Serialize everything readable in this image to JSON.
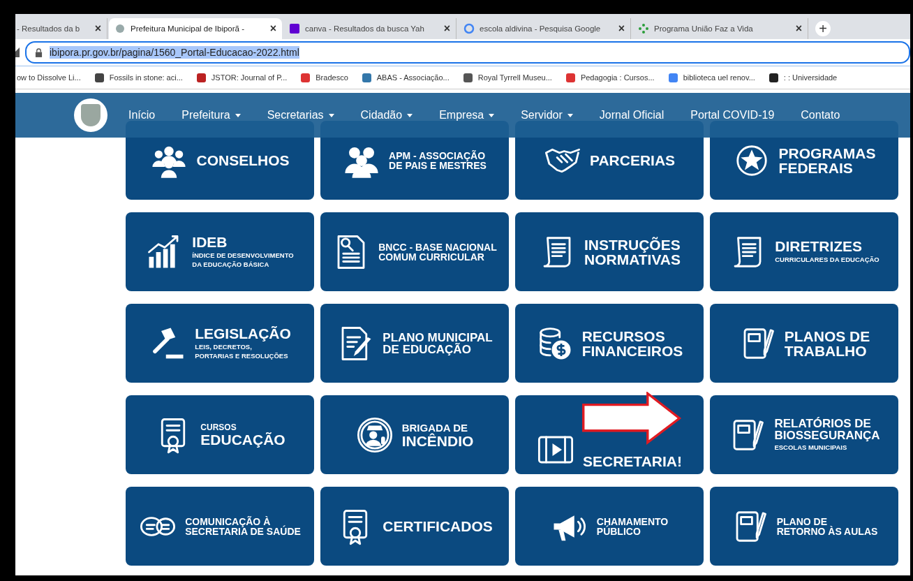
{
  "browser": {
    "tabs": [
      {
        "label": "- Resultados da b",
        "close": "×",
        "selected": false
      },
      {
        "label": "Prefeitura Municipal de Ibiporã -",
        "close": "×",
        "selected": true
      },
      {
        "label": "canva - Resultados da busca Yah",
        "close": "×",
        "selected": false
      },
      {
        "label": "escola aldivina - Pesquisa Google",
        "close": "×",
        "selected": false
      },
      {
        "label": "Programa União Faz a Vida",
        "close": "×",
        "selected": false
      }
    ],
    "new_tab": "+",
    "address": "ibipora.pr.gov.br/pagina/1560_Portal-Educacao-2022.html",
    "bookmarks": [
      "ow to Dissolve Li...",
      "Fossils in stone: aci...",
      "JSTOR: Journal of P...",
      "Bradesco",
      "ABAS - Associação...",
      "Royal Tyrrell Museu...",
      "Pedagogia : Cursos...",
      "biblioteca uel renov...",
      ": : Universidade"
    ]
  },
  "nav": [
    {
      "label": "Início",
      "dropdown": false
    },
    {
      "label": "Prefeitura",
      "dropdown": true
    },
    {
      "label": "Secretarias",
      "dropdown": true
    },
    {
      "label": "Cidadão",
      "dropdown": true
    },
    {
      "label": "Empresa",
      "dropdown": true
    },
    {
      "label": "Servidor",
      "dropdown": true
    },
    {
      "label": "Jornal Oficial",
      "dropdown": false
    },
    {
      "label": "Portal COVID-19",
      "dropdown": false
    },
    {
      "label": "Contato",
      "dropdown": false
    }
  ],
  "tiles": [
    {
      "kind": "headline",
      "title": "CONSELHOS"
    },
    {
      "kind": "compact",
      "title": "APM - ASSOCIAÇÃO\nDE PAIS E MESTRES"
    },
    {
      "kind": "headline",
      "title": "PARCERIAS"
    },
    {
      "kind": "headline",
      "title": "PROGRAMAS\nFEDERAIS"
    },
    {
      "kind": "headline",
      "title": "IDEB",
      "subtitle": "ÍNDICE DE DESENVOLVIMENTO\nDA EDUCAÇÃO BÁSICA"
    },
    {
      "kind": "compact",
      "title": "BNCC - BASE NACIONAL\nCOMUM CURRICULAR"
    },
    {
      "kind": "headline",
      "title": "INSTRUÇÕES\nNORMATIVAS"
    },
    {
      "kind": "headline",
      "title": "DIRETRIZES",
      "subtitle": "CURRICULARES DA EDUCAÇÃO"
    },
    {
      "kind": "headline",
      "title": "LEGISLAÇÃO",
      "subtitle": "LEIS, DECRETOS,\nPORTARIAS E RESOLUÇÕES"
    },
    {
      "kind": "medium",
      "title": "PLANO MUNICIPAL\nDE EDUCAÇÃO"
    },
    {
      "kind": "headline",
      "title": "RECURSOS\nFINANCEIROS"
    },
    {
      "kind": "headline",
      "title": "PLANOS DE\nTRABALHO"
    },
    {
      "kind": "headline",
      "kicker": "CURSOS",
      "title": "EDUCAÇÃO"
    },
    {
      "kind": "headline",
      "kicker": "BRIGADA DE",
      "title": "INCÊNDIO"
    },
    {
      "kind": "headline",
      "title": "SECRETARIA!"
    },
    {
      "kind": "medium",
      "title": "RELATÓRIOS DE\nBIOSSEGURANÇA",
      "subtitle": "ESCOLAS MUNICIPAIS"
    },
    {
      "kind": "compact",
      "title": "COMUNICAÇÃO À\nSECRETARIA DE SAÚDE"
    },
    {
      "kind": "headline",
      "title": "CERTIFICADOS"
    },
    {
      "kind": "compact",
      "title": "CHAMAMENTO\nPÚBLICO"
    },
    {
      "kind": "compact",
      "title": "PLANO DE\nRETORNO ÀS AULAS"
    }
  ],
  "annotation": {
    "kind": "arrow"
  }
}
